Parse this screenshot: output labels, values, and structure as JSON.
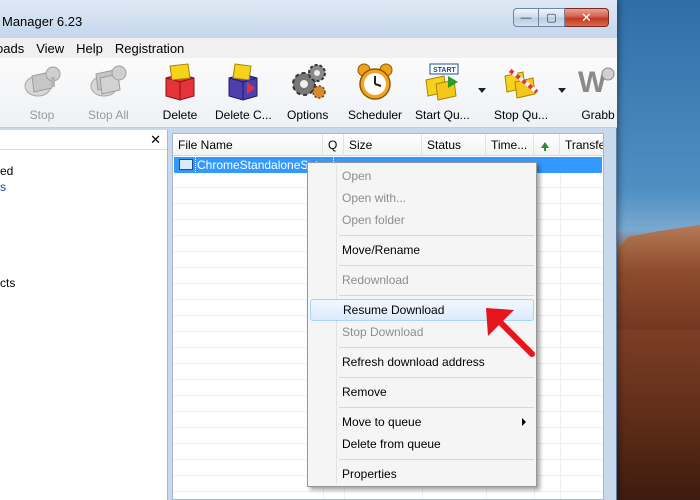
{
  "window": {
    "title": "Manager 6.23",
    "minimize_label": "—",
    "maximize_label": "▢",
    "close_label": "✕"
  },
  "menubar": [
    "oads",
    "View",
    "Help",
    "Registration"
  ],
  "toolbar": {
    "buttons": [
      {
        "label": "Stop",
        "icon": "stop-icon",
        "enabled": false
      },
      {
        "label": "Stop All",
        "icon": "stop-all-icon",
        "enabled": false
      },
      {
        "label": "Delete",
        "icon": "delete-icon",
        "enabled": true
      },
      {
        "label": "Delete C...",
        "icon": "delete-completed-icon",
        "enabled": true
      },
      {
        "label": "Options",
        "icon": "gear-icon",
        "enabled": true
      },
      {
        "label": "Scheduler",
        "icon": "alarm-clock-icon",
        "enabled": true
      },
      {
        "label": "Start Qu...",
        "icon": "start-queue-icon",
        "enabled": true
      },
      {
        "label": "Stop Qu...",
        "icon": "stop-queue-icon",
        "enabled": true
      },
      {
        "label": "Grabb",
        "icon": "grabber-icon",
        "enabled": true
      }
    ]
  },
  "left_pane": {
    "close_label": "✕",
    "tree_items": [
      "ed",
      "s",
      "cts"
    ]
  },
  "file_list": {
    "columns": [
      "File Name",
      "Q",
      "Size",
      "Status",
      "Time...",
      "",
      "Transfe"
    ],
    "selected_file": "ChromeStandaloneSetup"
  },
  "context_menu": {
    "items": [
      {
        "label": "Open",
        "enabled": false
      },
      {
        "label": "Open with...",
        "enabled": false
      },
      {
        "label": "Open folder",
        "enabled": false
      },
      {
        "label": "Move/Rename",
        "enabled": true
      },
      {
        "label": "Redownload",
        "enabled": false
      },
      {
        "label": "Resume Download",
        "enabled": true,
        "highlighted": true
      },
      {
        "label": "Stop Download",
        "enabled": false
      },
      {
        "label": "Refresh download address",
        "enabled": true
      },
      {
        "label": "Remove",
        "enabled": true
      },
      {
        "label": "Move to queue",
        "enabled": true,
        "submenu": true
      },
      {
        "label": "Delete from queue",
        "enabled": true
      },
      {
        "label": "Properties",
        "enabled": true
      }
    ]
  },
  "colors": {
    "selection": "#3399ff",
    "annotation": "#e8141b"
  }
}
